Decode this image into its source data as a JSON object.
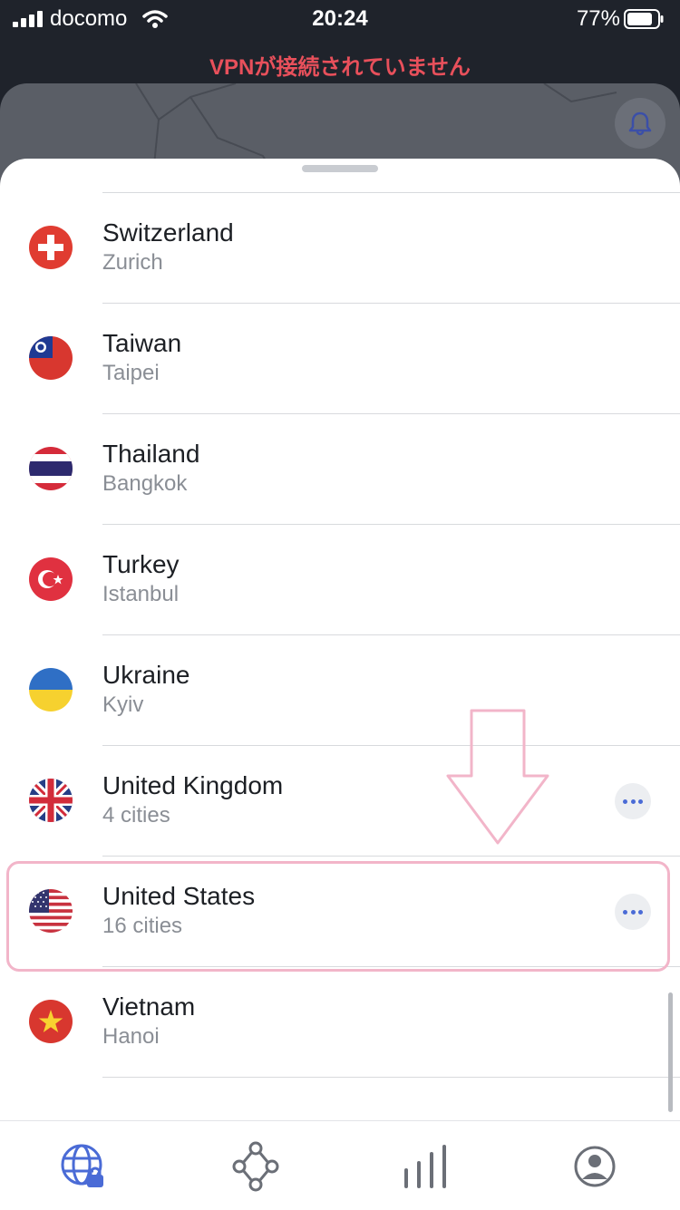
{
  "status_bar": {
    "carrier": "docomo",
    "time": "20:24",
    "battery": "77%"
  },
  "banner": {
    "text": "VPNが接続されていません"
  },
  "countries": [
    {
      "name": "Switzerland",
      "sub": "Zurich",
      "flag": "switzerland-flag",
      "has_more": false
    },
    {
      "name": "Taiwan",
      "sub": "Taipei",
      "flag": "taiwan-flag",
      "has_more": false
    },
    {
      "name": "Thailand",
      "sub": "Bangkok",
      "flag": "thailand-flag",
      "has_more": false
    },
    {
      "name": "Turkey",
      "sub": "Istanbul",
      "flag": "turkey-flag",
      "has_more": false
    },
    {
      "name": "Ukraine",
      "sub": "Kyiv",
      "flag": "ukraine-flag",
      "has_more": false
    },
    {
      "name": "United Kingdom",
      "sub": "4 cities",
      "flag": "uk-flag",
      "has_more": true
    },
    {
      "name": "United States",
      "sub": "16 cities",
      "flag": "us-flag",
      "has_more": true
    },
    {
      "name": "Vietnam",
      "sub": "Hanoi",
      "flag": "vietnam-flag",
      "has_more": false
    }
  ],
  "tabs": [
    {
      "name": "globe-lock-icon",
      "active": true
    },
    {
      "name": "nodes-icon",
      "active": false
    },
    {
      "name": "bars-icon",
      "active": false
    },
    {
      "name": "profile-icon",
      "active": false
    }
  ],
  "colors": {
    "banner": "#e8505b",
    "accent": "#4a6bd6",
    "highlight": "#f2b5c9"
  }
}
